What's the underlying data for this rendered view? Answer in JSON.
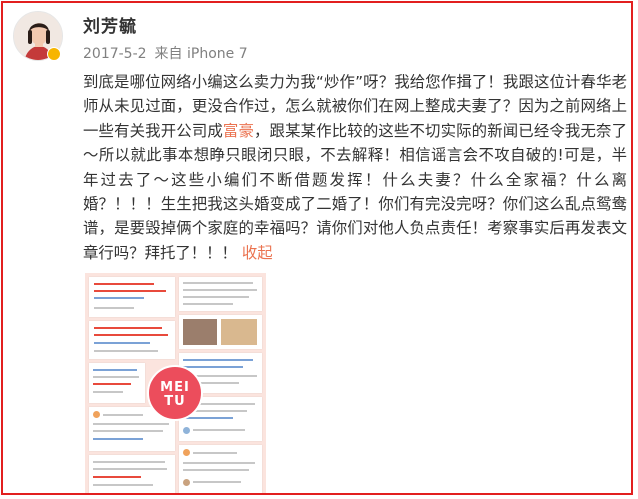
{
  "user": {
    "name": "刘芳毓",
    "verified_badge_color": "#f7b500"
  },
  "meta": {
    "date": "2017-5-2",
    "source": "来自 iPhone 7"
  },
  "post": {
    "part1": "到底是哪位网络小编这么卖力为我“炒作”呀？我给您作揖了！我跟这位计春华老师从未见过面，更没合作过，怎么就被你们在网上整成夫妻了？因为之前网络上一些有关我开公司成",
    "link_text": "富豪",
    "part2": "，跟某某作比较的这些不切实际的新闻已经令我无奈了～所以就此事本想睁只眼闭只眼，不去解释！相信谣言会不攻自破的!可是，半年过去了～这些小编们不断借题发挥！什么夫妻？什么全家福？什么离婚？！！！生生把我这头婚变成了二婚了！你们有完没完呀？你们这么乱点鸳鸯谱，是要毁掉俩个家庭的幸福吗？请你们对他人负点责任！考察事实后再发表文章行吗？拜托了！！！",
    "collapse_label": "收起",
    "link_color": "#eb7350"
  },
  "thumbnail": {
    "watermark": "MEI TU",
    "watermark_color": "#ec4d5c",
    "background_color": "#fbe4de"
  },
  "frame": {
    "border_color": "#e21f1f"
  }
}
